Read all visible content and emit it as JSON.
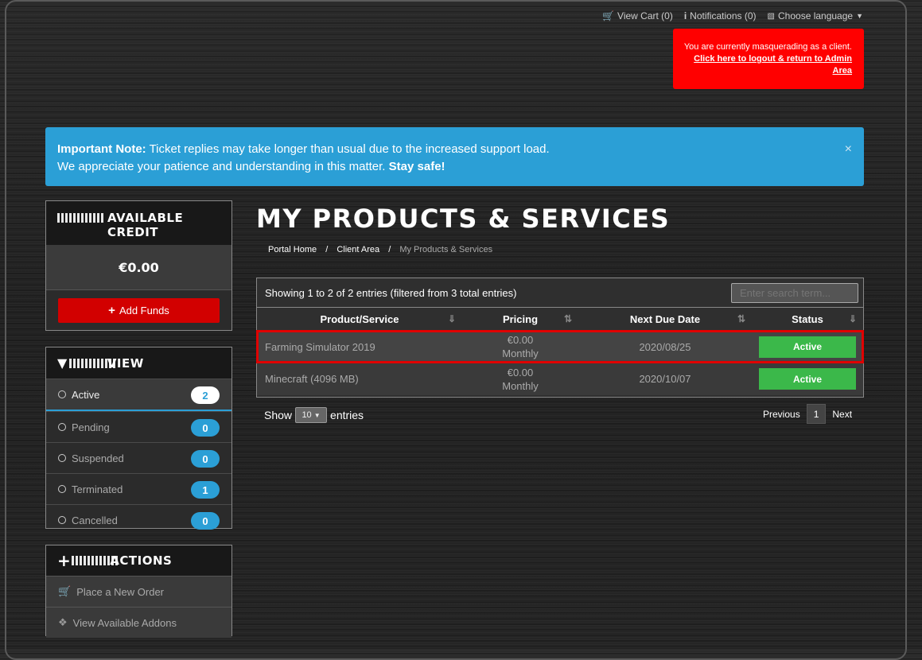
{
  "topnav": {
    "cart": "View Cart (0)",
    "notifications": "Notifications (0)",
    "language": "Choose language"
  },
  "masquerade": {
    "line1": "You are currently masquerading as a client.",
    "link": "Click here to logout & return to Admin Area"
  },
  "alert": {
    "bold": "Important Note:",
    "line1": " Ticket replies may take longer than usual due to the increased support load.",
    "line2": "We appreciate your patience and understanding in this matter. ",
    "line2_bold": "Stay safe!",
    "close": "×"
  },
  "credit": {
    "title": "AVAILABLE CREDIT",
    "amount": "€0.00",
    "button": "Add Funds"
  },
  "view": {
    "title": "VIEW",
    "items": [
      {
        "label": "Active",
        "count": "2"
      },
      {
        "label": "Pending",
        "count": "0"
      },
      {
        "label": "Suspended",
        "count": "0"
      },
      {
        "label": "Terminated",
        "count": "1"
      },
      {
        "label": "Cancelled",
        "count": "0"
      }
    ]
  },
  "actions": {
    "title": "ACTIONS",
    "items": [
      {
        "label": "Place a New Order"
      },
      {
        "label": "View Available Addons"
      }
    ]
  },
  "main": {
    "title": "MY PRODUCTS & SERVICES",
    "breadcrumb": [
      "Portal Home",
      "Client Area",
      "My Products & Services"
    ]
  },
  "table": {
    "info": "Showing 1 to 2 of 2 entries (filtered from 3 total entries)",
    "search_placeholder": "Enter search term...",
    "columns": [
      "Product/Service",
      "Pricing",
      "Next Due Date",
      "Status"
    ],
    "rows": [
      {
        "product": "Farming Simulator 2019",
        "price": "€0.00",
        "cycle": "Monthly",
        "due": "2020/08/25",
        "status": "Active"
      },
      {
        "product": "Minecraft (4096 MB)",
        "price": "€0.00",
        "cycle": "Monthly",
        "due": "2020/10/07",
        "status": "Active"
      }
    ],
    "show": "Show",
    "page_size": "10",
    "entries": "entries",
    "pager": {
      "prev": "Previous",
      "page": "1",
      "next": "Next"
    }
  },
  "colors": {
    "alert_blue": "#2b9fd6",
    "masquerade_red": "#ff0000",
    "add_funds_red": "#d20000",
    "status_green": "#3bb84a",
    "highlight_outline": "#e00000"
  }
}
